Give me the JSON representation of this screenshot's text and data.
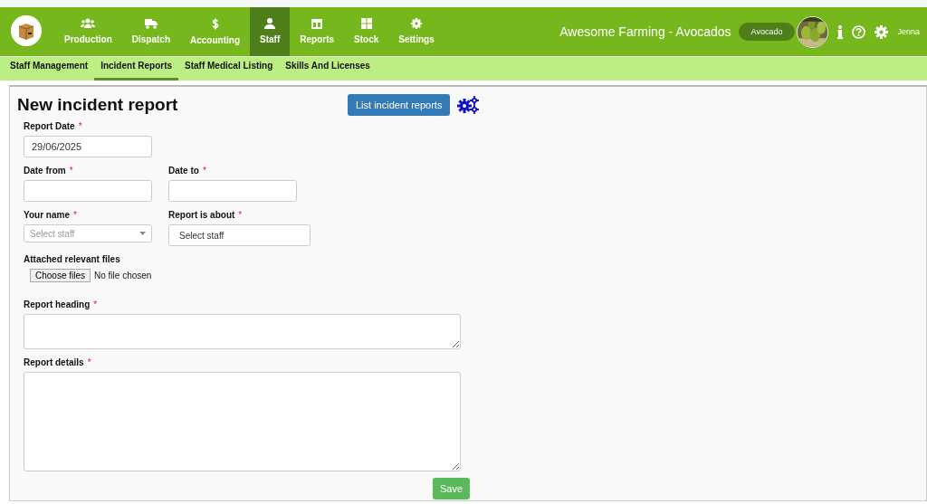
{
  "header": {
    "nav": [
      {
        "label": "Production",
        "selected": false
      },
      {
        "label": "Dispatch",
        "selected": false
      },
      {
        "label": "Accounting",
        "selected": false
      },
      {
        "label": "Staff",
        "selected": true
      },
      {
        "label": "Reports",
        "selected": false
      },
      {
        "label": "Stock",
        "selected": false
      },
      {
        "label": "Settings",
        "selected": false
      }
    ],
    "farm_title": "Awesome Farming - Avocados",
    "crop_pill": "Avocado",
    "user": "Jenna"
  },
  "subnav": [
    {
      "label": "Staff Management",
      "selected": false
    },
    {
      "label": "Incident Reports",
      "selected": true
    },
    {
      "label": "Staff Medical Listing",
      "selected": false
    },
    {
      "label": "Skills And Licenses",
      "selected": false
    }
  ],
  "form": {
    "title": "New incident report",
    "list_button": "List incident reports",
    "rows": [
      [
        {
          "label": "Report Date",
          "required_mark": "*",
          "kind": "text",
          "value": "29/06/2025"
        }
      ],
      [
        {
          "label": "Date from",
          "required_mark": "*",
          "kind": "text"
        },
        {
          "label": "Date to",
          "required_mark": "*",
          "kind": "text"
        }
      ],
      [
        {
          "label": "Your name",
          "required_mark": "*",
          "kind": "select",
          "placeholder": "Select staff"
        },
        {
          "label": "Report is about",
          "required_mark": "*",
          "kind": "multiselect",
          "placeholder": "Select staff"
        }
      ],
      [
        {
          "label": "Attached relevant files",
          "kind": "file",
          "button": "Choose files",
          "status": "No file chosen"
        }
      ],
      [
        {
          "label": "Report heading",
          "required_mark": "*",
          "kind": "textbox"
        }
      ],
      [
        {
          "label": "Report details",
          "required_mark": "*",
          "kind": "textarea"
        }
      ]
    ],
    "save_button": "Save"
  }
}
